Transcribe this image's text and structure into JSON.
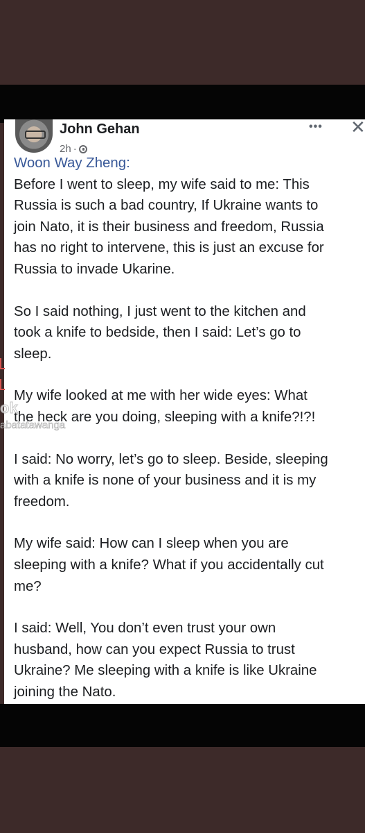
{
  "post": {
    "author": "John Gehan",
    "time": "2h",
    "separator": "·",
    "more_label": "•••",
    "close_label": "✕",
    "quoted_author": "Woon Way Zheng:",
    "paragraphs": [
      "Before I went to sleep, my wife said to me: This\nRussia is such a bad country, If Ukraine wants to\njoin Nato, it is their business and freedom, Russia\nhas no right to intervene, this is just an excuse for\nRussia to invade Ukarine.",
      "So I said nothing, I just went to the kitchen and\ntook a knife to bedside, then I said: Let’s go to\nsleep.",
      "My wife looked at me with her wide eyes: What\nthe heck are you doing, sleeping with a knife?!?!",
      "I said: No worry, let’s go to sleep. Beside, sleeping\nwith a knife is none of your business and it is my\nfreedom.",
      "My wife said: How can I sleep when you are\nsleeping with a knife? What if you accidentally cut\nme?",
      "I said: Well, You don’t even trust your own\nhusband, how can you expect Russia to trust\nUkraine? Me sleeping with a knife is like Ukraine\njoining the Nato."
    ]
  },
  "watermark": {
    "ok": "ok",
    "username": "abatatawanga"
  },
  "colors": {
    "background": "#3d2a29",
    "band": "#050505",
    "link_blue": "#385898",
    "text": "#1c1e21",
    "meta": "#65676b"
  }
}
